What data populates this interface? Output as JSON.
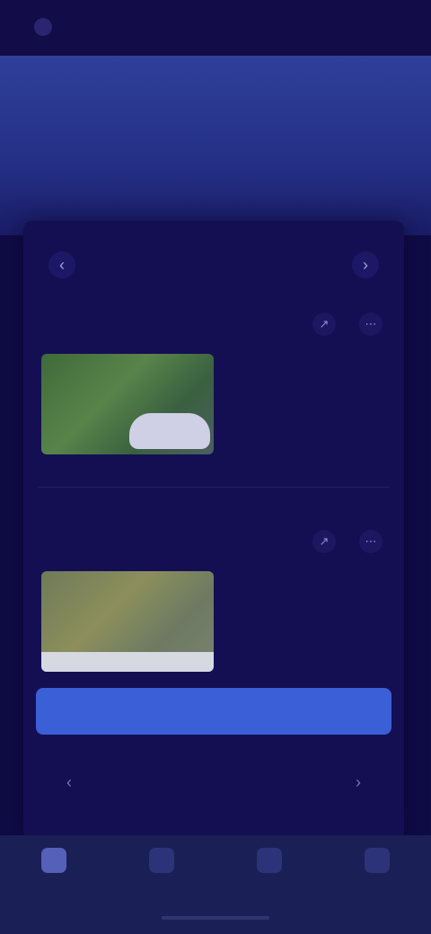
{
  "status_bar": {
    "left_text": "",
    "right_text": ""
  },
  "header": {
    "title": "",
    "subtitle": "",
    "tabs": [
      {
        "label": ""
      },
      {
        "label": ""
      },
      {
        "label": ""
      },
      {
        "label": ""
      }
    ]
  },
  "card": {
    "title": "",
    "prev_icon": "chevron-left-icon",
    "next_icon": "chevron-right-icon",
    "facts": [
      {
        "label": "",
        "text": "",
        "image": "green-landscape-with-cloud"
      },
      {
        "label": "",
        "text": "",
        "image": "olive-landscape-with-white-band"
      }
    ],
    "cta_label": "",
    "pager_text": ""
  },
  "bottom_nav": {
    "items": [
      {
        "icon": "home-icon",
        "label": ""
      },
      {
        "icon": "explore-icon",
        "label": ""
      },
      {
        "icon": "bookmark-icon",
        "label": ""
      },
      {
        "icon": "profile-icon",
        "label": ""
      }
    ]
  },
  "colors": {
    "background": "#0f0b45",
    "hero": "#2f3f9a",
    "card": "#140f52",
    "accent": "#3a5fd6",
    "bottom_nav": "#1a1f55"
  }
}
